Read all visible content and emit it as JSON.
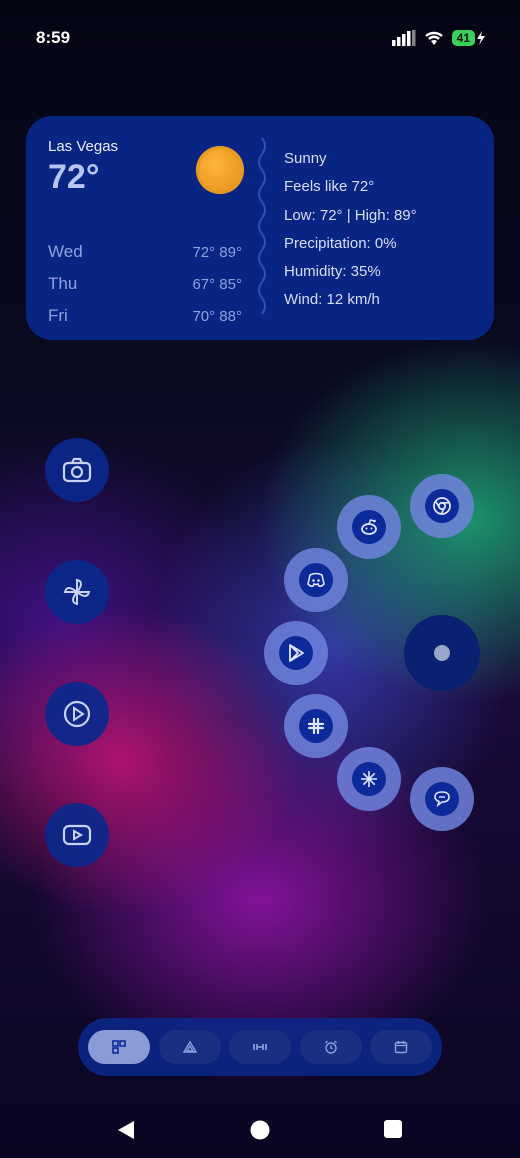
{
  "status_bar": {
    "time": "8:59",
    "battery": "41"
  },
  "weather": {
    "city": "Las Vegas",
    "temperature": "72°",
    "condition_icon": "sun-icon",
    "forecast": [
      {
        "day": "Wed",
        "temps": "72° 89°"
      },
      {
        "day": "Thu",
        "temps": "67° 85°"
      },
      {
        "day": "Fri",
        "temps": "70° 88°"
      }
    ],
    "condition": "Sunny",
    "feels_like": "Feels like 72°",
    "low_high": "Low: 72°  |  High: 89°",
    "precipitation": "Precipitation: 0%",
    "humidity": "Humidity: 35%",
    "wind": "Wind: 12 km/h"
  },
  "left_apps": [
    "camera-icon",
    "pinwheel-icon",
    "play-circle-icon",
    "youtube-icon"
  ],
  "radial_apps": [
    "chrome-icon",
    "reddit-icon",
    "discord-icon",
    "play-store-icon",
    "slack-icon",
    "perplexity-icon",
    "chat-icon"
  ],
  "dock": [
    "widgets-icon",
    "triangle-icon",
    "link-icon",
    "alarm-icon",
    "calendar-icon"
  ],
  "colors": {
    "widget_bg": "#0a288c",
    "bubble": "#6e82dc",
    "accent_battery": "#3ad15a"
  }
}
